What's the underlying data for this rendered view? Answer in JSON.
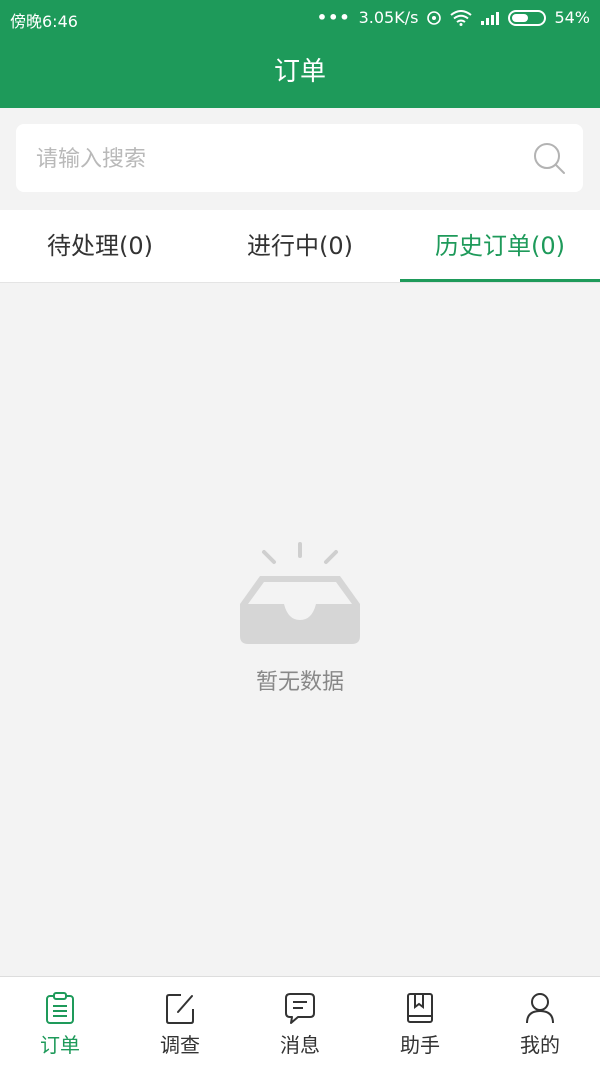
{
  "status_bar": {
    "time": "傍晚6:46",
    "dots": "•••",
    "speed": "3.05K/s",
    "battery": "54%",
    "battery_level": 0.54
  },
  "header": {
    "title": "订单"
  },
  "search": {
    "placeholder": "请输入搜索",
    "value": ""
  },
  "tabs": [
    {
      "label": "待处理(0)"
    },
    {
      "label": "进行中(0)"
    },
    {
      "label": "历史订单(0)"
    }
  ],
  "empty_state": {
    "text": "暂无数据"
  },
  "bottom_nav": [
    {
      "label": "订单",
      "icon": "clipboard-icon"
    },
    {
      "label": "调查",
      "icon": "edit-icon"
    },
    {
      "label": "消息",
      "icon": "message-icon"
    },
    {
      "label": "助手",
      "icon": "book-icon"
    },
    {
      "label": "我的",
      "icon": "user-icon"
    }
  ],
  "colors": {
    "brand": "#1e9a5a",
    "background": "#f3f3f3"
  }
}
